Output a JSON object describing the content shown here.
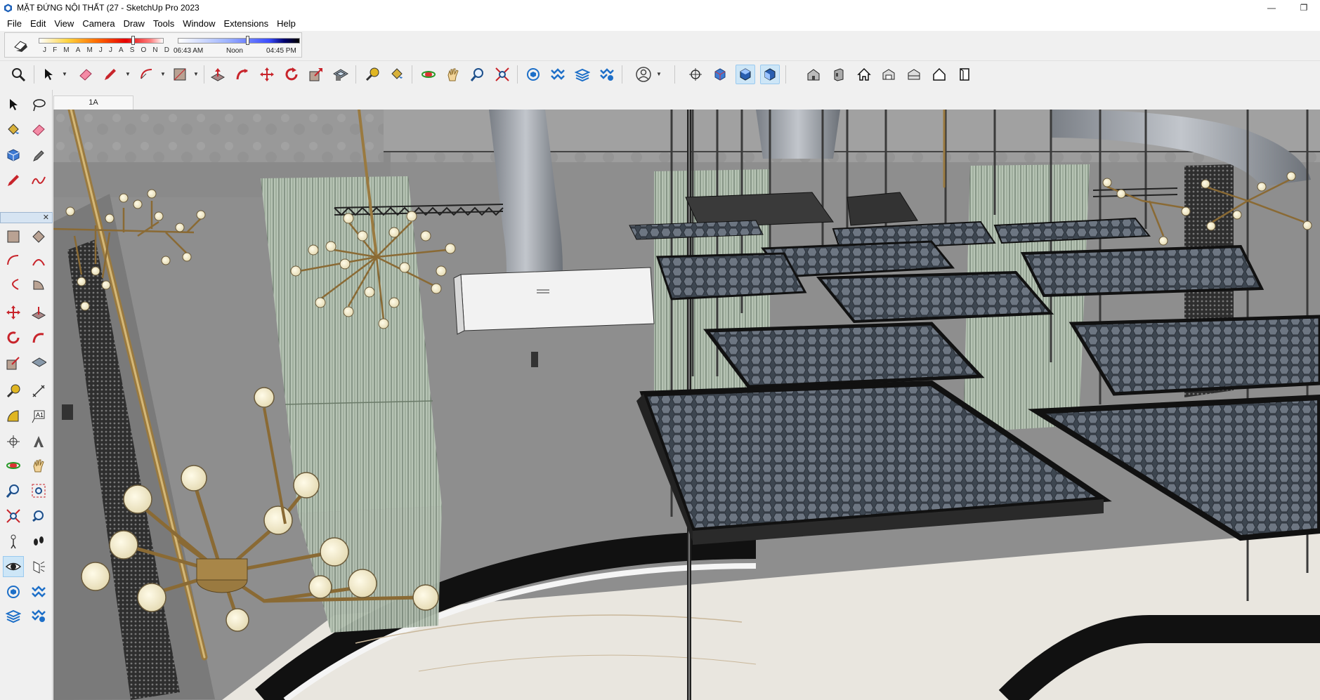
{
  "window": {
    "title": "MẶT ĐỨNG NỘI THẤT (27 - SketchUp Pro 2023",
    "minimize_glyph": "—",
    "maximize_glyph": "❐"
  },
  "menu": [
    "File",
    "Edit",
    "View",
    "Camera",
    "Draw",
    "Tools",
    "Window",
    "Extensions",
    "Help"
  ],
  "shadows": {
    "months": [
      "J",
      "F",
      "M",
      "A",
      "M",
      "J",
      "J",
      "A",
      "S",
      "O",
      "N",
      "D"
    ],
    "month_level": 0.75,
    "time_start": "06:43 AM",
    "time_mid": "Noon",
    "time_end": "04:45 PM",
    "time_level": 0.57
  },
  "main_toolbar": {
    "icons": [
      "zoom-extents-icon",
      "select-icon",
      "eraser-icon",
      "pencil-icon",
      "arc-icon",
      "rectangle-icon",
      "push-pull-icon",
      "follow-me-icon",
      "move-icon",
      "rotate-icon",
      "scale-icon",
      "offset-icon",
      "tape-measure-icon",
      "paint-bucket-icon",
      "orbit-icon",
      "pan-icon",
      "zoom-icon",
      "zoom-window-icon",
      "components-icon",
      "tags-icon",
      "materials-icon",
      "styles-icon",
      "account-icon",
      "position-camera-icon",
      "iso-view-icon",
      "top-view-icon",
      "front-view-icon",
      "iso-house-icon",
      "right-view-icon",
      "home-view-icon",
      "back-view-icon",
      "left-view-icon",
      "house-outline-icon",
      "section-plane-icon"
    ]
  },
  "scene": {
    "tab_label": "1A"
  },
  "colors": {
    "accent_active": "#cde6f7",
    "chrome": "#f0f0f0",
    "sky": "#8f8f8f"
  }
}
